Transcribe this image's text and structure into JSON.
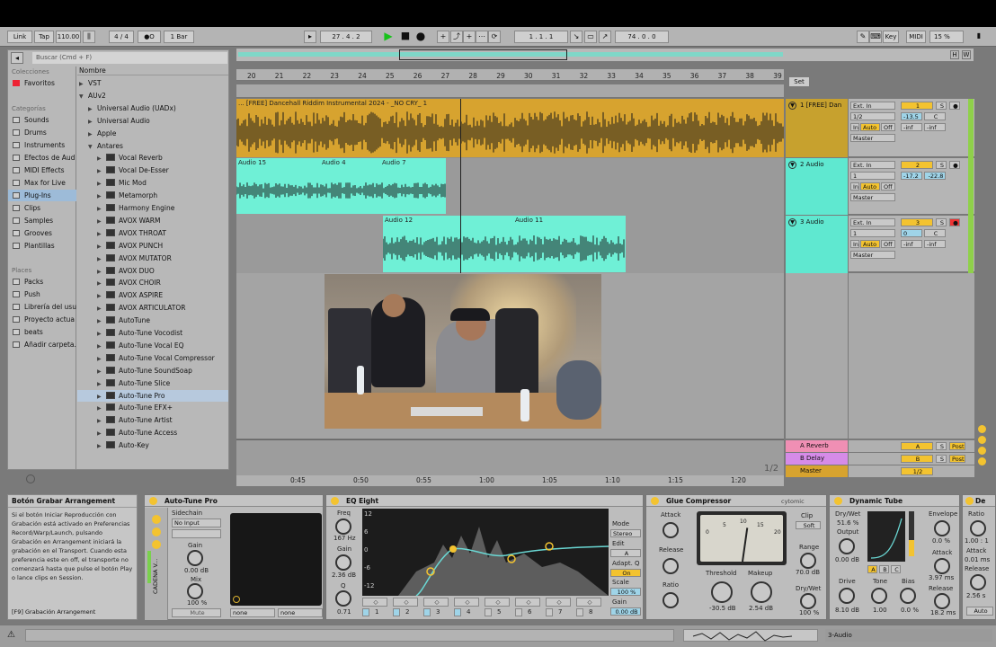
{
  "transport": {
    "link": "Link",
    "tap": "Tap",
    "tempo": "110.00",
    "signature": "4 / 4",
    "metro": "●O",
    "quantize": "1 Bar",
    "position": "27 .  4 .  2",
    "loop_start": "1 .  1 .  1",
    "loop_length": "74 .  0 .  0",
    "key": "Key",
    "midi": "MIDI",
    "cpu": "15 %"
  },
  "browser": {
    "search_placeholder": "Buscar (Cmd + F)",
    "collections_header": "Colecciones",
    "favorites": "Favoritos",
    "categories_header": "Categorías",
    "categories": [
      "Sounds",
      "Drums",
      "Instruments",
      "Efectos de Aud",
      "MIDI Effects",
      "Max for Live",
      "Plug-Ins",
      "Clips",
      "Samples",
      "Grooves",
      "Plantillas"
    ],
    "places_header": "Places",
    "places": [
      "Packs",
      "Push",
      "Librería del usu",
      "Proyecto actua",
      "beats",
      "Añadir carpeta..."
    ],
    "name_header": "Nombre",
    "items": [
      {
        "label": "VST",
        "level": 1,
        "arrow": "▶"
      },
      {
        "label": "AUv2",
        "level": 1,
        "arrow": "▼"
      },
      {
        "label": "Universal Audio (UADx)",
        "level": 2,
        "arrow": "▶"
      },
      {
        "label": "Universal Audio",
        "level": 2,
        "arrow": "▶"
      },
      {
        "label": "Apple",
        "level": 2,
        "arrow": "▶"
      },
      {
        "label": "Antares",
        "level": 2,
        "arrow": "▼"
      },
      {
        "label": "Vocal Reverb",
        "level": 3
      },
      {
        "label": "Vocal De-Esser",
        "level": 3
      },
      {
        "label": "Mic Mod",
        "level": 3
      },
      {
        "label": "Metamorph",
        "level": 3
      },
      {
        "label": "Harmony Engine",
        "level": 3
      },
      {
        "label": "AVOX WARM",
        "level": 3
      },
      {
        "label": "AVOX THROAT",
        "level": 3
      },
      {
        "label": "AVOX PUNCH",
        "level": 3
      },
      {
        "label": "AVOX MUTATOR",
        "level": 3
      },
      {
        "label": "AVOX DUO",
        "level": 3
      },
      {
        "label": "AVOX CHOIR",
        "level": 3
      },
      {
        "label": "AVOX ASPIRE",
        "level": 3
      },
      {
        "label": "AVOX ARTICULATOR",
        "level": 3
      },
      {
        "label": "AutoTune",
        "level": 3
      },
      {
        "label": "Auto-Tune Vocodist",
        "level": 3
      },
      {
        "label": "Auto-Tune Vocal EQ",
        "level": 3
      },
      {
        "label": "Auto-Tune Vocal Compressor",
        "level": 3
      },
      {
        "label": "Auto-Tune SoundSoap",
        "level": 3
      },
      {
        "label": "Auto-Tune Slice",
        "level": 3
      },
      {
        "label": "Auto-Tune Pro",
        "level": 3,
        "selected": true
      },
      {
        "label": "Auto-Tune EFX+",
        "level": 3
      },
      {
        "label": "Auto-Tune Artist",
        "level": 3
      },
      {
        "label": "Auto-Tune Access",
        "level": 3
      },
      {
        "label": "Auto-Key",
        "level": 3
      }
    ]
  },
  "arrangement": {
    "bars": [
      "20",
      "21",
      "22",
      "23",
      "24",
      "25",
      "26",
      "27",
      "28",
      "29",
      "30",
      "31",
      "32",
      "33",
      "34",
      "35",
      "36",
      "37",
      "38",
      "39"
    ],
    "set_label": "Set",
    "times": [
      "0:45",
      "0:50",
      "0:55",
      "1:00",
      "1:05",
      "1:10",
      "1:15",
      "1:20"
    ],
    "page_indicator": "1/2",
    "tracks": [
      {
        "name": "1 [FREE] Dan",
        "color": "#d7a32f",
        "input": "Ext. In",
        "channel": "1/2",
        "output": "Master",
        "number": "1",
        "vol": "-13.5",
        "pan": "C",
        "peak1": "-inf",
        "peak2": "-inf",
        "clips": [
          {
            "name": "... [FREE] Dancehall Riddim Instrumental 2024 - _NO CRY_ 1"
          }
        ]
      },
      {
        "name": "2 Audio",
        "color": "#5fe8d0",
        "input": "Ext. In",
        "channel": "1",
        "output": "Master",
        "number": "2",
        "vol": "-17.2",
        "pan": "-22.8",
        "clips": [
          {
            "name": "Audio 15"
          },
          {
            "name": "Audio 4"
          },
          {
            "name": "Audio 7"
          }
        ]
      },
      {
        "name": "3 Audio",
        "color": "#5fe8d0",
        "input": "Ext. In",
        "channel": "1",
        "output": "Master",
        "number": "3",
        "vol": "0",
        "pan": "C",
        "peak1": "-inf",
        "peak2": "-inf",
        "clips": [
          {
            "name": "Audio 12"
          },
          {
            "name": "Audio 11"
          }
        ]
      }
    ],
    "returns": [
      {
        "name": "A Reverb",
        "letter": "A",
        "color": "#f08fb4"
      },
      {
        "name": "B Delay",
        "letter": "B",
        "color": "#d68be8"
      },
      {
        "name": "Master",
        "letter": "1/2",
        "color": "#d7a32f"
      }
    ],
    "mixer_labels": {
      "in": "In",
      "auto": "Auto",
      "off": "Off",
      "solo": "S",
      "post": "Post"
    }
  },
  "info_panel": {
    "title": "Botón Grabar Arrangement",
    "body": "Si el botón Iniciar Reproducción con Grabación está activado en Preferencias Record/Warp/Launch, pulsando Grabación en Arrangement iniciará la grabación en el Transport. Cuando esta preferencia este en off, el transporte no comenzará hasta que pulse el botón Play o lance clips en Session.",
    "shortcut": "[F9] Grabación Arrangement"
  },
  "devices": {
    "autotune": {
      "title": "Auto-Tune Pro",
      "sidechain": "Sidechain",
      "sidechain_value": "No Input",
      "gain": "Gain",
      "gain_value": "0.00 dB",
      "mix": "Mix",
      "mix_value": "100 %",
      "mute": "Mute",
      "none1": "none",
      "none2": "none",
      "chain_label": "CADENA V..."
    },
    "eq": {
      "title": "EQ Eight",
      "freq": "Freq",
      "freq_value": "167 Hz",
      "gain": "Gain",
      "gain_value": "2.36 dB",
      "q": "Q",
      "q_value": "0.71",
      "mode": "Mode",
      "mode_value": "Stereo",
      "edit": "Edit",
      "edit_value": "A",
      "adapt": "Adapt. Q",
      "adapt_value": "On",
      "scale": "Scale",
      "scale_value": "100 %",
      "out_gain": "Gain",
      "out_gain_value": "0.00 dB",
      "db_labels": [
        "12",
        "6",
        "0",
        "-6",
        "-12"
      ],
      "bands": [
        "1",
        "2",
        "3",
        "4",
        "5",
        "6",
        "7",
        "8"
      ]
    },
    "glue": {
      "title": "Glue Compressor",
      "brand": "cytomic",
      "attack": "Attack",
      "release": "Release",
      "ratio": "Ratio",
      "threshold": "Threshold",
      "threshold_value": "-30.5 dB",
      "makeup": "Makeup",
      "makeup_value": "2.54 dB",
      "clip": "Clip",
      "soft": "Soft",
      "range": "Range",
      "range_value": "70.0 dB",
      "drywet": "Dry/Wet",
      "drywet_value": "100 %",
      "meter_marks": [
        "0",
        "5",
        "10",
        "15",
        "20"
      ]
    },
    "tube": {
      "title": "Dynamic Tube",
      "drywet": "Dry/Wet",
      "drywet_value": "51.6 %",
      "output": "Output",
      "output_value": "0.00 dB",
      "drive": "Drive",
      "drive_value": "8.10 dB",
      "tone": "Tone",
      "tone_value": "1.00",
      "bias": "Bias",
      "bias_value": "0.0 %",
      "envelope": "Envelope",
      "envelope_value": "0.0 %",
      "attack": "Attack",
      "attack_value": "3.97 ms",
      "release": "Release",
      "release_value": "18.2 ms",
      "modes": [
        "A",
        "B",
        "C"
      ]
    },
    "extra": {
      "title": "De",
      "ratio": "Ratio",
      "ratio_value": "1.00 : 1",
      "attack": "Attack",
      "attack_value": "0.01 ms",
      "release": "Release",
      "release_value": "2.56 s",
      "auto": "Auto"
    }
  },
  "status": {
    "track": "3-Audio"
  }
}
